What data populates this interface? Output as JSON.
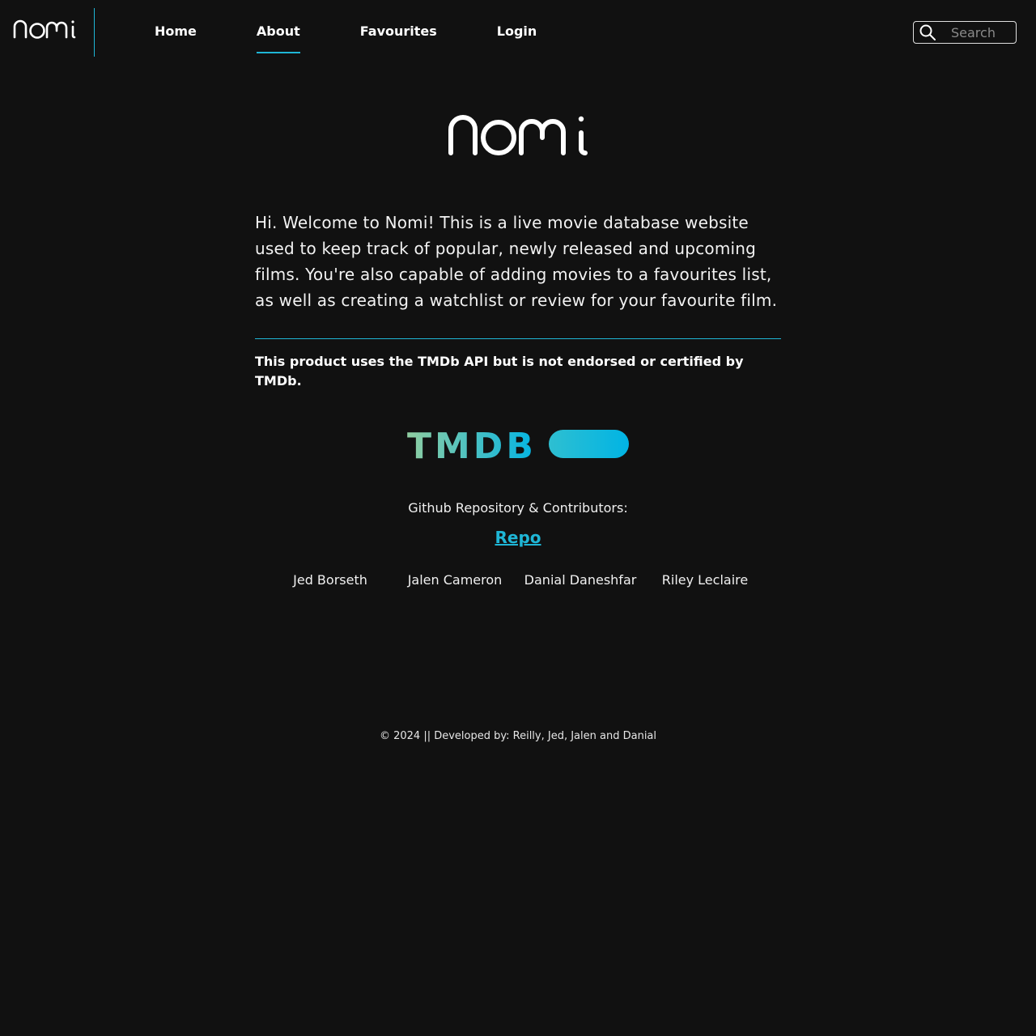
{
  "header": {
    "brand": "nomi",
    "nav": [
      {
        "label": "Home",
        "active": false
      },
      {
        "label": "About",
        "active": true
      },
      {
        "label": "Favourites",
        "active": false
      },
      {
        "label": "Login",
        "active": false
      }
    ],
    "search": {
      "placeholder": "Search",
      "value": ""
    }
  },
  "main": {
    "logo_text": "nomi",
    "intro": "Hi. Welcome to Nomi! This is a live movie database website used to keep track of popular, newly released and upcoming films. You're also capable of adding movies to a favourites list, as well as creating a watchlist or review for your favourite film.",
    "disclaimer": "This product uses the TMDb API but is not endorsed or certified by TMDb.",
    "tmdb_logo_text": "TMDB",
    "repo_heading": "Github Repository & Contributors:",
    "repo_link": "Repo",
    "contributors": [
      "Jed Borseth",
      "Jalen Cameron",
      "Danial Daneshfar",
      "Riley Leclaire"
    ]
  },
  "footer": {
    "text": "© 2024 || Developed by: Reilly, Jed, Jalen and Danial"
  },
  "colors": {
    "background": "#111111",
    "accent": "#1fb6d6",
    "tmdb_gradient_start": "#90cea1",
    "tmdb_gradient_end": "#01b4e4"
  }
}
